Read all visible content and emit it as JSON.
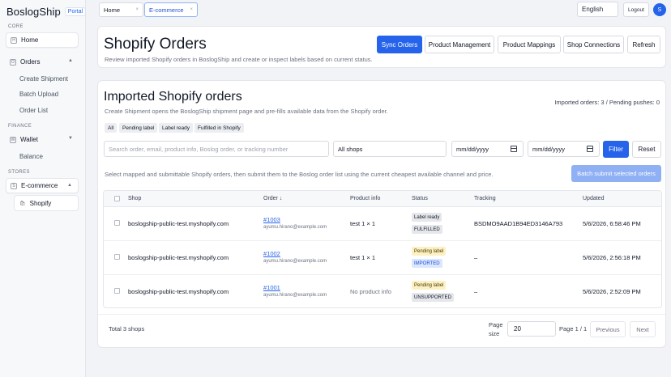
{
  "app": {
    "brand": "BoslogShip",
    "badge": "Portal"
  },
  "sidebar": {
    "sections": {
      "core": "CORE",
      "finance": "FINANCE",
      "stores": "STORES"
    },
    "home": {
      "label": "Home",
      "icon": "H"
    },
    "orders": {
      "label": "Orders",
      "icon": "O"
    },
    "order_children": [
      "Create Shipment",
      "Batch Upload",
      "Order List"
    ],
    "wallet": {
      "label": "Wallet",
      "icon": "W"
    },
    "wallet_children": [
      "Balance"
    ],
    "ecommerce": {
      "label": "E-commerce",
      "icon": "S"
    },
    "shopify": {
      "label": "Shopify",
      "icon": "🛍"
    }
  },
  "topbar": {
    "tabs": [
      "Home",
      "E-commerce"
    ],
    "language": "English",
    "logout": "Logout",
    "avatar": "S"
  },
  "header": {
    "title": "Shopify Orders",
    "subtitle": "Review imported Shopify orders in BoslogShip and create or inspect labels based on current status.",
    "buttons": [
      "Sync Orders",
      "Product Management",
      "Product Mappings",
      "Shop Connections",
      "Refresh"
    ]
  },
  "panel": {
    "title": "Imported Shopify orders",
    "subtitle": "Create Shipment opens the BoslogShip shipment page and pre-fills available data from the Shopify order.",
    "counts": "Imported orders: 3 / Pending pushes: 0",
    "chips": [
      "All",
      "Pending label",
      "Label ready",
      "Fulfilled in Shopify"
    ],
    "filters": {
      "search_placeholder": "Search order, email, product info, Boslog order, or tracking number",
      "shop": "All shops",
      "date_from": "mm/dd/yyyy",
      "date_to": "mm/dd/yyyy",
      "filter": "Filter",
      "reset": "Reset"
    },
    "help": "Select mapped and submittable Shopify orders, then submit them to the Boslog order list using the current cheapest available channel and price.",
    "batch": "Batch submit selected orders"
  },
  "table": {
    "columns": [
      "Shop",
      "Order ↓",
      "Product info",
      "Status",
      "Tracking",
      "Updated"
    ],
    "rows": [
      {
        "shop": "boslogship-public-test.myshopify.com",
        "order": "#1003",
        "email": "ayumu.hirano@example.com",
        "product": "test 1 × 1",
        "status": [
          "Label ready",
          "FULFILLED"
        ],
        "tracking": "BSDMO9AAD1B94ED3146A793",
        "updated": "5/6/2026, 6:58:46 PM"
      },
      {
        "shop": "boslogship-public-test.myshopify.com",
        "order": "#1002",
        "email": "ayumu.hirano@example.com",
        "product": "test 1 × 1",
        "status": [
          "Pending label",
          "IMPORTED"
        ],
        "tracking": "–",
        "updated": "5/6/2026, 2:56:18 PM"
      },
      {
        "shop": "boslogship-public-test.myshopify.com",
        "order": "#1001",
        "email": "ayumu.hirano@example.com",
        "product": "No product info",
        "status": [
          "Pending label",
          "UNSUPPORTED"
        ],
        "tracking": "–",
        "updated": "5/6/2026, 2:52:09 PM"
      }
    ]
  },
  "pagination": {
    "total": "Total 3 shops",
    "page_size_label": "Page size",
    "page_size": "20",
    "page_info": "Page 1 / 1",
    "prev": "Previous",
    "next": "Next"
  },
  "colors": {
    "primary": "#2563eb",
    "primary_disabled": "#8fb0f3"
  }
}
